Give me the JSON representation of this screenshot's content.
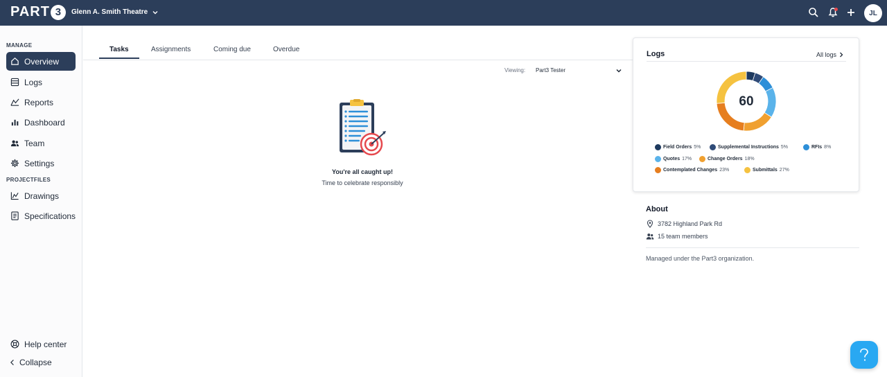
{
  "topbar": {
    "logo_text": "PART",
    "logo_mark": "3",
    "project_name": "Glenn A. Smith Theatre",
    "avatar_initials": "JL",
    "icons": [
      "search-icon",
      "bell-icon",
      "plus-icon"
    ]
  },
  "sidebar": {
    "manage_label": "MANAGE",
    "manage_items": [
      {
        "label": "Overview",
        "icon": "home-icon",
        "active": true
      },
      {
        "label": "Logs",
        "icon": "list-icon"
      },
      {
        "label": "Reports",
        "icon": "chart-line-icon"
      },
      {
        "label": "Dashboard",
        "icon": "bar-chart-icon"
      },
      {
        "label": "Team",
        "icon": "people-icon"
      },
      {
        "label": "Settings",
        "icon": "gear-icon"
      }
    ],
    "projectfiles_label": "PROJECTFILES",
    "projectfiles_items": [
      {
        "label": "Drawings",
        "icon": "drawing-icon"
      },
      {
        "label": "Specifications",
        "icon": "document-icon"
      }
    ],
    "footer_items": [
      {
        "label": "Help center",
        "icon": "help-circle-icon"
      },
      {
        "label": "Collapse",
        "icon": "chevron-left-icon"
      }
    ]
  },
  "tabs": [
    {
      "label": "Tasks",
      "active": true
    },
    {
      "label": "Assignments"
    },
    {
      "label": "Coming due"
    },
    {
      "label": "Overdue"
    }
  ],
  "viewing": {
    "label": "Viewing:",
    "value": "Part3 Tester"
  },
  "empty_state": {
    "title": "You're all caught up!",
    "subtitle": "Time to celebrate responsibly",
    "illustration": "clipboard-target-icon"
  },
  "logs_card": {
    "title": "Logs",
    "all_logs_label": "All logs",
    "total": "60",
    "legend": [
      {
        "name": "Field Orders",
        "pct": "5%",
        "value": 5,
        "color": "#1e3a5f"
      },
      {
        "name": "Supplemental Instructions",
        "pct": "5%",
        "value": 5,
        "color": "#2f4b78"
      },
      {
        "name": "RFIs",
        "pct": "8%",
        "value": 8,
        "color": "#2d8fd8"
      },
      {
        "name": "Quotes",
        "pct": "17%",
        "value": 17,
        "color": "#5ab3ea"
      },
      {
        "name": "Change Orders",
        "pct": "18%",
        "value": 18,
        "color": "#f0a030"
      },
      {
        "name": "Contemplated Changes",
        "pct": "23%",
        "value": 23,
        "color": "#e67e1f"
      },
      {
        "name": "Submittals",
        "pct": "27%",
        "value": 27,
        "color": "#f5c240"
      }
    ]
  },
  "about": {
    "title": "About",
    "address": "3782 Highland Park Rd",
    "team_members": "15 team members",
    "note": "Managed under the Part3 organization."
  }
}
